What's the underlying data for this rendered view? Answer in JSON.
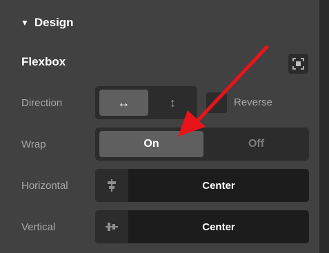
{
  "section": {
    "title": "Design",
    "toggle_icon": "triangle-down-icon"
  },
  "flexbox": {
    "title": "Flexbox",
    "expand_icon": "fullscreen-icon"
  },
  "direction": {
    "label": "Direction",
    "options": [
      {
        "icon": "horizontal-arrows-icon",
        "glyph": "↔",
        "selected": true
      },
      {
        "icon": "vertical-arrows-icon",
        "glyph": "↕",
        "selected": false
      }
    ],
    "reverse_label": "Reverse",
    "reverse_checked": false
  },
  "wrap": {
    "label": "Wrap",
    "on_label": "On",
    "off_label": "Off",
    "selected": "On"
  },
  "horizontal": {
    "label": "Horizontal",
    "value": "Center",
    "icon": "align-center-horizontal-icon"
  },
  "vertical": {
    "label": "Vertical",
    "value": "Center",
    "icon": "align-center-vertical-icon"
  },
  "annotation": {
    "color": "#e8141a",
    "points_to": "wrap-on-button"
  },
  "colors": {
    "panel": "#414141",
    "control": "#2c2c2c",
    "selected": "#5f5f5f",
    "value_bg": "#1c1c1c"
  }
}
